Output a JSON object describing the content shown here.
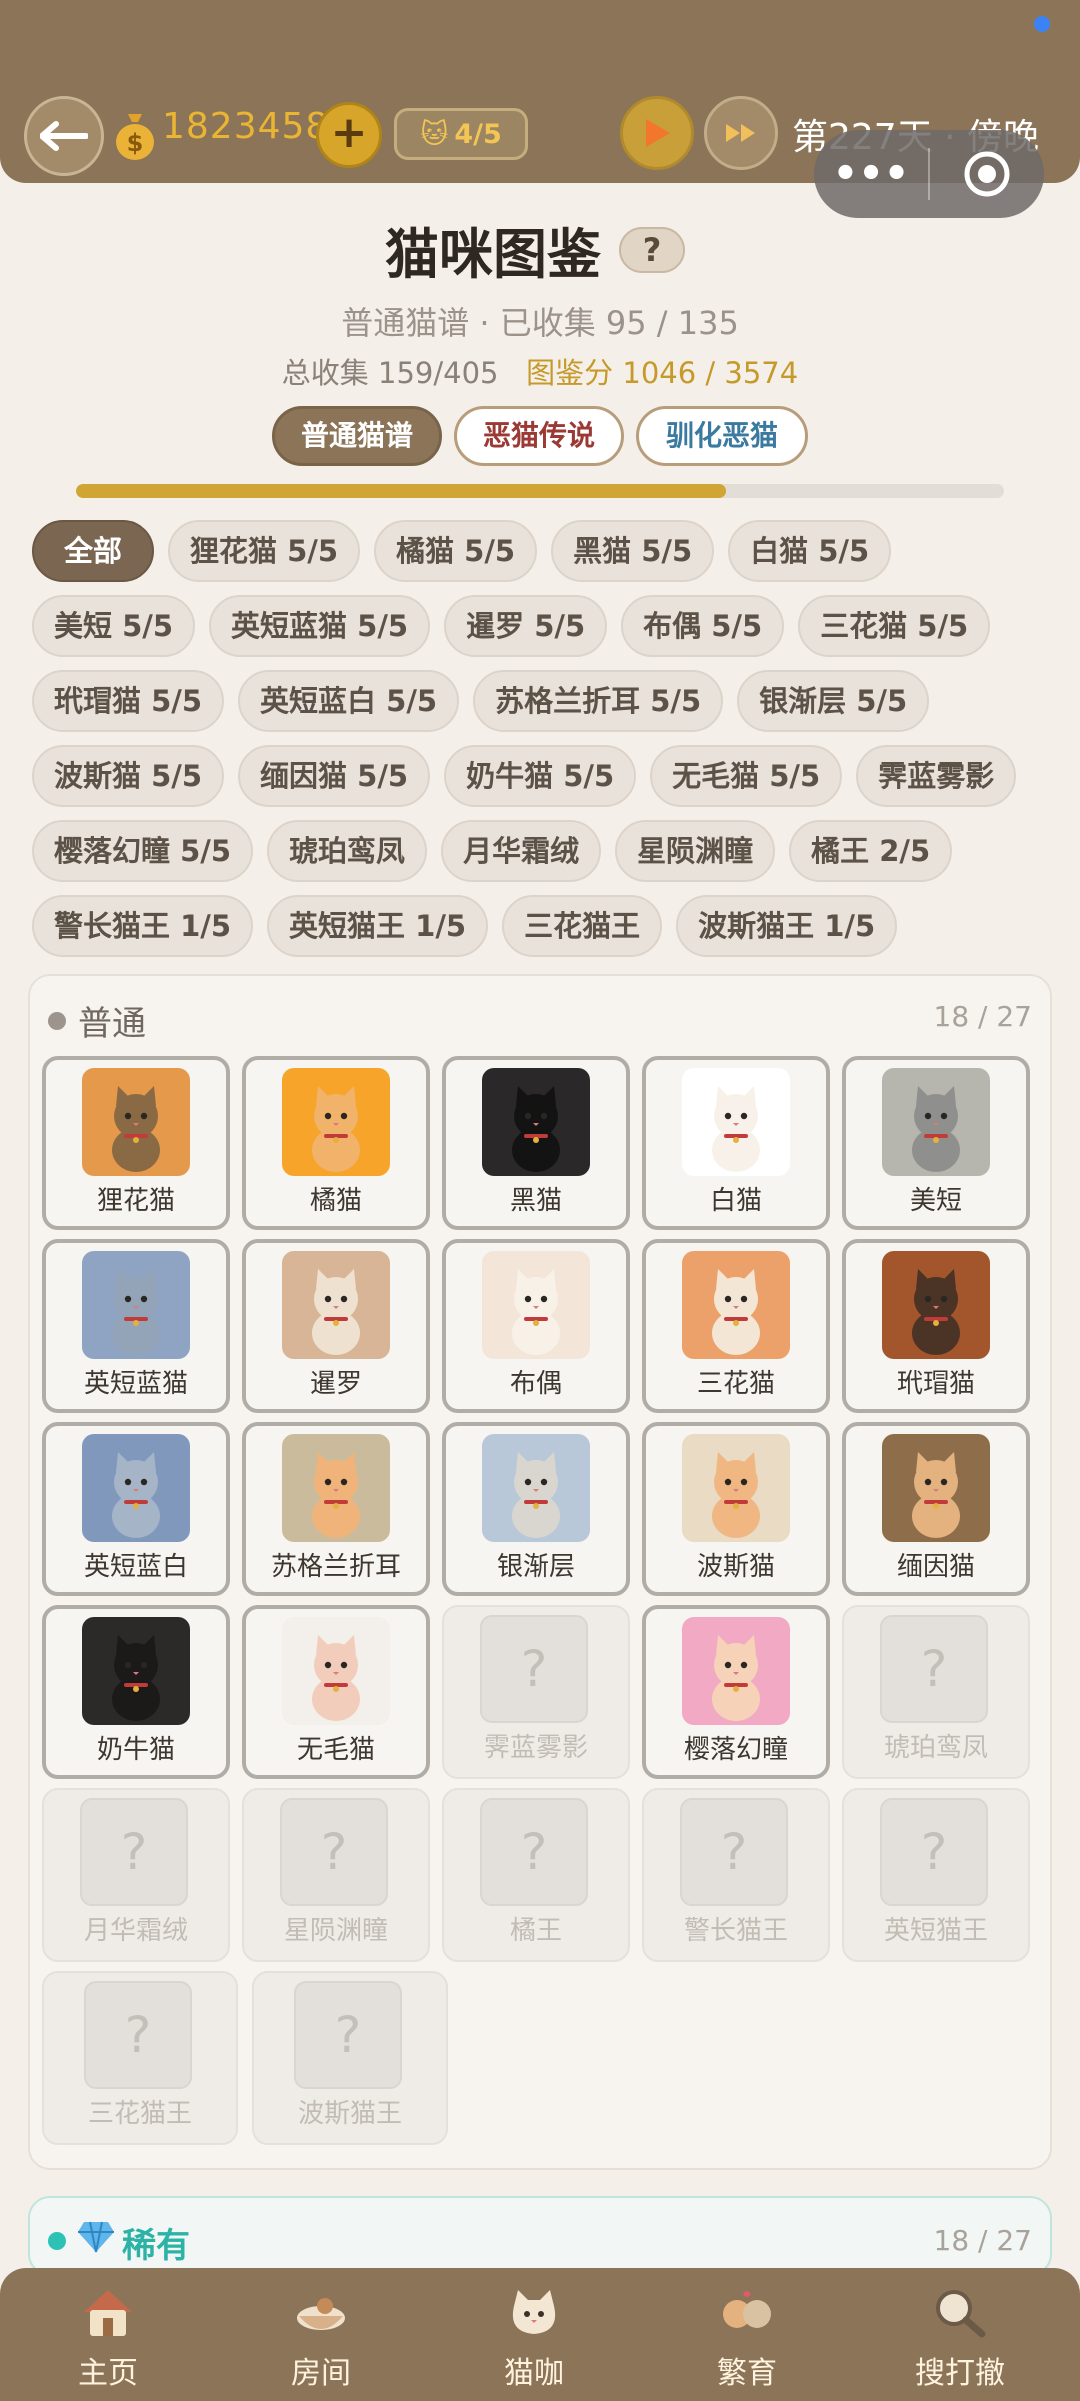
{
  "header": {
    "coins": "1823458",
    "cat_count": "4/5",
    "day_label": "第227天 · 傍晚"
  },
  "title": {
    "text": "猫咪图鉴",
    "help": "?",
    "subtitle": "普通猫谱 · 已收集 95 / 135",
    "total_label": "总收集 159/405",
    "score_label": "图鉴分 1046 / 3574"
  },
  "tabs": {
    "normal": "普通猫谱",
    "legend": "恶猫传说",
    "tame": "驯化恶猫"
  },
  "progress": {
    "value": 0.7
  },
  "chips": [
    "全部",
    "狸花猫 5/5",
    "橘猫 5/5",
    "黑猫 5/5",
    "白猫 5/5",
    "美短 5/5",
    "英短蓝猫 5/5",
    "暹罗 5/5",
    "布偶 5/5",
    "三花猫 5/5",
    "玳瑁猫 5/5",
    "英短蓝白 5/5",
    "苏格兰折耳 5/5",
    "银渐层 5/5",
    "波斯猫 5/5",
    "缅因猫 5/5",
    "奶牛猫 5/5",
    "无毛猫 5/5",
    "霁蓝雾影",
    "樱落幻瞳 5/5",
    "琥珀鸾凤",
    "月华霜绒",
    "星陨渊瞳",
    "橘王 2/5",
    "警长猫王 1/5",
    "英短猫王 1/5",
    "三花猫王",
    "波斯猫王 1/5"
  ],
  "normal_section": {
    "title": "普通",
    "count": "18 / 27",
    "cards": [
      {
        "name": "狸花猫",
        "bg": "#e49a4a",
        "fur": "#8a6a45",
        "locked": false
      },
      {
        "name": "橘猫",
        "bg": "#f6a42a",
        "fur": "#f1b26a",
        "locked": false
      },
      {
        "name": "黑猫",
        "bg": "#2a2828",
        "fur": "#141313",
        "locked": false
      },
      {
        "name": "白猫",
        "bg": "#ffffff",
        "fur": "#f7f1ea",
        "locked": false
      },
      {
        "name": "美短",
        "bg": "#b6b6ae",
        "fur": "#8f8f8d",
        "locked": false
      },
      {
        "name": "英短蓝猫",
        "bg": "#8ea4c2",
        "fur": "#93a3b8",
        "locked": false
      },
      {
        "name": "暹罗",
        "bg": "#d8b597",
        "fur": "#efe1cf",
        "locked": false
      },
      {
        "name": "布偶",
        "bg": "#f3e6d8",
        "fur": "#f8f1e8",
        "locked": false
      },
      {
        "name": "三花猫",
        "bg": "#eca06a",
        "fur": "#f4e6d4",
        "locked": false
      },
      {
        "name": "玳瑁猫",
        "bg": "#a3562c",
        "fur": "#4b3325",
        "locked": false
      },
      {
        "name": "英短蓝白",
        "bg": "#7f98bb",
        "fur": "#a6b4c8",
        "locked": false
      },
      {
        "name": "苏格兰折耳",
        "bg": "#cbbb9d",
        "fur": "#f0b37a",
        "locked": false
      },
      {
        "name": "银渐层",
        "bg": "#b9c8d8",
        "fur": "#d9d6cf",
        "locked": false
      },
      {
        "name": "波斯猫",
        "bg": "#eadbc4",
        "fur": "#f0b783",
        "locked": false
      },
      {
        "name": "缅因猫",
        "bg": "#8e6d4b",
        "fur": "#e4b27e",
        "locked": false
      },
      {
        "name": "奶牛猫",
        "bg": "#2c2a28",
        "fur": "#1b1a19",
        "locked": false
      },
      {
        "name": "无毛猫",
        "bg": "#f3efeb",
        "fur": "#f2cdbc",
        "locked": false
      },
      {
        "name": "霁蓝雾影",
        "locked": true
      },
      {
        "name": "樱落幻瞳",
        "bg": "#f2a9c4",
        "fur": "#f6d2b8",
        "locked": false
      },
      {
        "name": "琥珀鸾凤",
        "locked": true
      },
      {
        "name": "月华霜绒",
        "locked": true
      },
      {
        "name": "星陨渊瞳",
        "locked": true
      },
      {
        "name": "橘王",
        "locked": true
      },
      {
        "name": "警长猫王",
        "locked": true
      },
      {
        "name": "英短猫王",
        "locked": true
      },
      {
        "name": "三花猫王",
        "locked": true
      },
      {
        "name": "波斯猫王",
        "locked": true
      }
    ],
    "locked_mark": "?"
  },
  "rare_section": {
    "title": "稀有",
    "count": "18 / 27",
    "dot_color": "#2ec2b6"
  },
  "bottom_nav": [
    {
      "label": "主页",
      "icon": "house-icon"
    },
    {
      "label": "房间",
      "icon": "room-bowl-icon"
    },
    {
      "label": "猫咖",
      "icon": "cat-cafe-icon"
    },
    {
      "label": "繁育",
      "icon": "breeding-icon"
    },
    {
      "label": "搜打撤",
      "icon": "search-magnifier-icon"
    }
  ],
  "colors": {
    "brand_brown": "#8b7457",
    "gold": "#d0a534",
    "legend_red": "#9b3a35",
    "tame_blue": "#3b7aa0"
  }
}
